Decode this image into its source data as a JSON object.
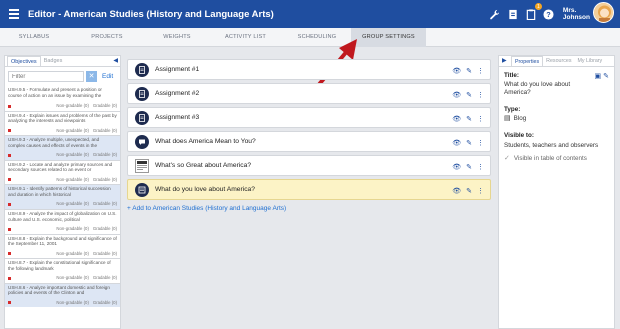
{
  "header": {
    "title": "Editor - American Studies (History and Language Arts)",
    "notification_count": "1",
    "user_name_line1": "Mrs.",
    "user_name_line2": "Johnson"
  },
  "tabs": [
    {
      "label": "SYLLABUS"
    },
    {
      "label": "PROJECTS"
    },
    {
      "label": "WEIGHTS"
    },
    {
      "label": "ACTIVITY LIST"
    },
    {
      "label": "SCHEDULING"
    },
    {
      "label": "GROUP SETTINGS"
    }
  ],
  "left_panel": {
    "tabs": [
      "Objectives",
      "Badges"
    ],
    "filter_placeholder": "Filter",
    "edit_label": "Edit",
    "items": [
      {
        "text": "USH.9.5 - Formulate and present a position or course of action on an issue by examining the",
        "ng": "Non-gradable (0)",
        "g": "Gradable (0)"
      },
      {
        "text": "USH.9.4 - Explain issues and problems of the past by analyzing the interests and viewpoints",
        "ng": "Non-gradable (0)",
        "g": "Gradable (0)"
      },
      {
        "text": "USH.9.3 - Analyze multiple, unexpected, and complex causes and effects of events in the",
        "ng": "Non-gradable (0)",
        "g": "Gradable (0)"
      },
      {
        "text": "USH.9.2 - Locate and analyze primary sources and secondary sources related to an event or",
        "ng": "Non-gradable (0)",
        "g": "Gradable (0)"
      },
      {
        "text": "USH.9.1 - Identify patterns of historical succession and duration in which historical",
        "ng": "Non-gradable (0)",
        "g": "Gradable (0)"
      },
      {
        "text": "USH.8.9 - Analyze the impact of globalization on U.S. culture and U.S. economic, political",
        "ng": "Non-gradable (0)",
        "g": "Gradable (0)"
      },
      {
        "text": "USH.8.8 - Explain the background and significance of the September 11, 2001",
        "ng": "Non-gradable (0)",
        "g": "Gradable (0)"
      },
      {
        "text": "USH.8.7 - Explain the constitutional significance of the following landmark",
        "ng": "Non-gradable (0)",
        "g": "Gradable (0)"
      },
      {
        "text": "USH.8.6 - Analyze important domestic and foreign policies and events of the Clinton and",
        "ng": "Non-gradable (0)",
        "g": "Gradable (0)"
      }
    ]
  },
  "center": {
    "items": [
      {
        "title": "Assignment #1",
        "icon": "document-icon"
      },
      {
        "title": "Assignment #2",
        "icon": "document-icon"
      },
      {
        "title": "Assignment #3",
        "icon": "document-icon"
      },
      {
        "title": "What does America Mean to You?",
        "icon": "discussion-icon"
      },
      {
        "title": "What's so Great about America?",
        "icon": "thumbnail-icon"
      },
      {
        "title": "What do you love about America?",
        "icon": "blog-icon"
      }
    ],
    "add_link": "+ Add to American Studies (History and Language Arts)"
  },
  "right_panel": {
    "tabs": [
      "Properties",
      "Resources",
      "My Library"
    ],
    "title_label": "Title:",
    "title_value": "What do you love about America?",
    "type_label": "Type:",
    "type_value": "Blog",
    "visible_label": "Visible to:",
    "visible_value": "Students, teachers and observers",
    "toc_label": "Visible in table of contents"
  },
  "colors": {
    "header": "#1f4ea0",
    "selected_item": "#fcf3c6",
    "arrow": "#c0181e"
  }
}
